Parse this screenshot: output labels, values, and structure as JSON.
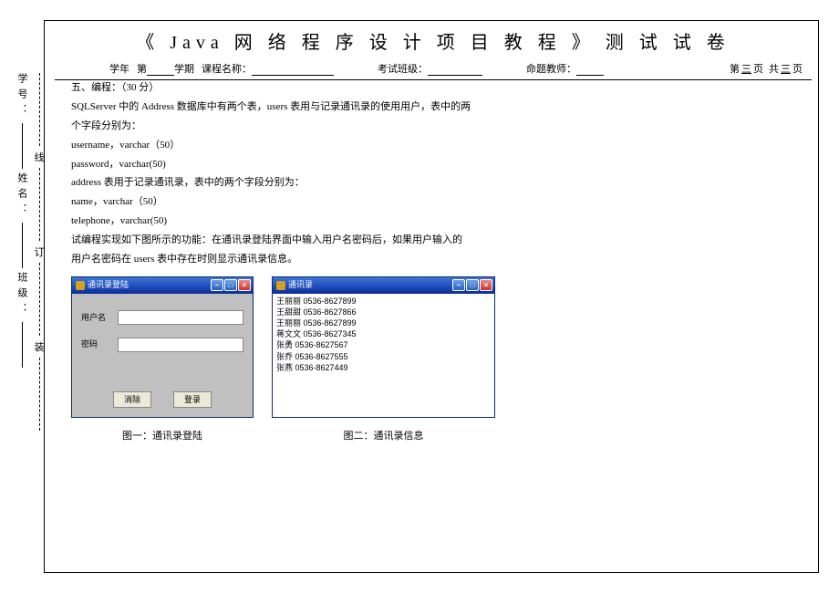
{
  "header": {
    "title": "《 Java 网 络 程 序 设 计 项 目 教 程 》 测 试 试 卷",
    "meta": {
      "year_label": "学年",
      "term_prefix": "第",
      "term_suffix": "学期",
      "course_label": "课程名称：",
      "class_label": "考试班级：",
      "teacher_label": "命题教师：",
      "page_prefix": "第",
      "page_mid": "页",
      "page_total_prefix": "共",
      "page_total_suffix": "页",
      "page_num": "三",
      "page_total": "三"
    }
  },
  "side": {
    "labels": [
      "学号：",
      "姓名：",
      "班级："
    ],
    "binding": [
      "线",
      "订",
      "装"
    ]
  },
  "content": {
    "q_title": "五、编程：（30 分）",
    "p1": "SQLServer 中的 Address 数据库中有两个表，users 表用与记录通讯录的使用用户，表中的两",
    "p2": "个字段分别为：",
    "f1": "username，varchar（50）",
    "f2": "password，varchar(50)",
    "p3": "address 表用于记录通讯录，表中的两个字段分别为：",
    "f3": "name，varchar（50）",
    "f4": "telephone，varchar(50)",
    "p4": "试编程实现如下图所示的功能：在通讯录登陆界面中输入用户名密码后，如果用户输入的",
    "p5": "用户名密码在 users 表中存在时则显示通讯录信息。"
  },
  "win1": {
    "title": "通讯录登陆",
    "label_user": "用户名",
    "label_pass": "密码",
    "btn_clear": "消除",
    "btn_login": "登录"
  },
  "win2": {
    "title": "通讯录",
    "rows": [
      "王丽丽 0536-8627899",
      "王甜甜 0536-8627866",
      "王丽丽 0536-8627899",
      "蒋文文 0536-8627345",
      "张勇 0536-8627567",
      "张乔 0536-8627555",
      "张燕 0536-8627449"
    ]
  },
  "captions": {
    "c1": "图一：通讯录登陆",
    "c2": "图二：通讯录信息"
  }
}
